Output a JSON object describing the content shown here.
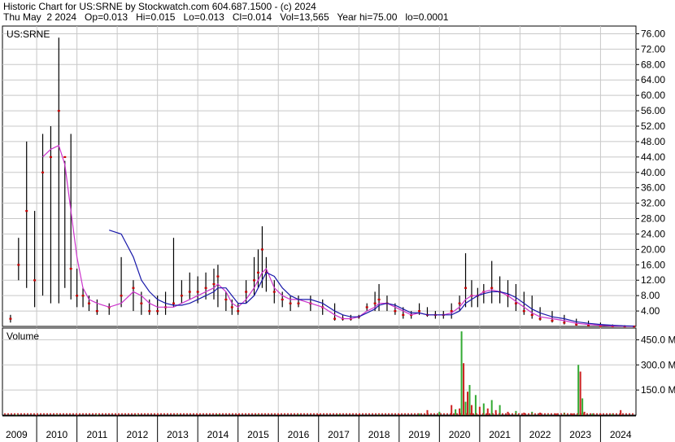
{
  "header": {
    "line1": "Historic Chart for US:SRNE by Stockwatch.com 604.687.1500 - (c) 2024",
    "line2": "Thu May  2 2024   Op=0.013   Hi=0.015   Lo=0.013   Cl=0.014   Vol=13,565   Year hi=75.00   lo=0.0001"
  },
  "colors": {
    "price_bar": "#000000",
    "close_marker": "#cc0000",
    "ma_short": "#cc33cc",
    "ma_long": "#1a1aaa",
    "volume_up": "#33aa33",
    "volume_down": "#cc2222",
    "grid": "#c8c8c8"
  },
  "chart_data": [
    {
      "type": "line",
      "title": "US:SRNE",
      "ylim": [
        0,
        78
      ],
      "y_ticks": [
        "4.00",
        "8.00",
        "12.00",
        "16.00",
        "20.00",
        "24.00",
        "28.00",
        "32.00",
        "36.00",
        "40.00",
        "44.00",
        "48.00",
        "52.00",
        "56.00",
        "60.00",
        "64.00",
        "68.00",
        "72.00",
        "76.00"
      ],
      "x_tick_labels": [
        "2009",
        "2010",
        "2011",
        "2012",
        "2013",
        "2014",
        "2015",
        "2016",
        "2017",
        "2018",
        "2019",
        "2020",
        "2021",
        "2022",
        "2023",
        "2024"
      ],
      "x": [
        2008.85,
        2009.05,
        2009.25,
        2009.45,
        2009.65,
        2009.85,
        2010.05,
        2010.2,
        2010.35,
        2010.5,
        2010.65,
        2010.8,
        2011.0,
        2011.3,
        2011.6,
        2011.9,
        2012.1,
        2012.3,
        2012.5,
        2012.7,
        2012.9,
        2013.1,
        2013.3,
        2013.5,
        2013.7,
        2013.9,
        2014.0,
        2014.2,
        2014.35,
        2014.5,
        2014.7,
        2014.9,
        2015.0,
        2015.1,
        2015.2,
        2015.4,
        2015.6,
        2015.8,
        2016.0,
        2016.3,
        2016.6,
        2016.9,
        2017.1,
        2017.3,
        2017.5,
        2017.7,
        2017.9,
        2018.0,
        2018.2,
        2018.4,
        2018.6,
        2018.8,
        2019.0,
        2019.2,
        2019.4,
        2019.6,
        2019.8,
        2020.0,
        2020.15,
        2020.3,
        2020.45,
        2020.6,
        2020.8,
        2021.0,
        2021.2,
        2021.4,
        2021.6,
        2021.8,
        2022.0,
        2022.3,
        2022.6,
        2022.9,
        2023.2,
        2023.5,
        2023.8,
        2024.1,
        2024.33
      ],
      "series": [
        {
          "kind": "ohlc",
          "high": [
            3,
            23,
            48,
            30,
            50,
            52,
            75,
            43,
            50,
            15,
            10,
            8,
            7,
            6,
            18,
            12,
            9,
            7,
            8,
            9,
            23,
            12,
            14,
            13,
            14,
            15,
            16,
            9,
            7,
            6,
            12,
            18,
            20,
            26,
            18,
            12,
            9,
            8,
            8,
            8,
            7,
            6,
            3,
            3,
            3,
            6,
            9,
            11,
            8,
            6,
            5,
            4,
            6,
            5,
            4,
            4,
            6,
            8,
            19,
            12,
            10,
            11,
            17,
            13,
            12,
            11,
            9,
            8,
            5,
            4,
            3,
            2,
            1.5,
            1,
            0.5,
            0.3,
            0.2
          ],
          "low": [
            1,
            12,
            10,
            5,
            8,
            6,
            6,
            10,
            7,
            5,
            5,
            4,
            3,
            3,
            5,
            4,
            3,
            3,
            3,
            3,
            5,
            6,
            7,
            6,
            7,
            7,
            5,
            4,
            3,
            3,
            6,
            8,
            10,
            10,
            9,
            6,
            5,
            4,
            5,
            4,
            3,
            1.5,
            1.5,
            1.5,
            2,
            4,
            4,
            4,
            4,
            3,
            2,
            2,
            3,
            2.5,
            2,
            2,
            2,
            4,
            5,
            5,
            5,
            6,
            6,
            6,
            5,
            4,
            3,
            2,
            1.5,
            1,
            0.5,
            0.2,
            0.1,
            0.05,
            0.02,
            0.01,
            0.01
          ],
          "close": [
            2,
            16,
            30,
            12,
            40,
            44,
            56,
            44,
            15,
            8,
            8,
            6,
            4,
            5,
            8,
            10,
            6,
            4,
            4,
            5,
            6,
            8,
            9,
            9,
            10,
            11,
            13,
            7,
            5,
            4,
            9,
            12,
            14,
            20,
            14,
            9,
            7,
            6,
            6,
            6,
            5,
            2,
            2,
            2,
            2.5,
            5,
            6,
            7,
            6,
            4,
            3,
            3,
            4,
            3,
            3,
            3,
            4,
            6,
            10,
            8,
            8,
            9,
            10,
            9,
            8,
            6,
            4,
            3,
            2,
            1.5,
            1,
            0.5,
            0.3,
            0.1,
            0.05,
            0.02,
            0.014
          ]
        },
        {
          "kind": "ma_short",
          "values": [
            null,
            null,
            null,
            null,
            44,
            46,
            47,
            42,
            30,
            18,
            10,
            7,
            6,
            5,
            6,
            9,
            8,
            6,
            5,
            5,
            5,
            6,
            7,
            8,
            9,
            10,
            11,
            9,
            6,
            5,
            7,
            10,
            12,
            14,
            15,
            10,
            8,
            7,
            7,
            6,
            5,
            3,
            2,
            2,
            2.5,
            4,
            5,
            6,
            6,
            5,
            4,
            3,
            3.5,
            3,
            3,
            3,
            3.5,
            5,
            7,
            8,
            8,
            9,
            9.5,
            9,
            8,
            6.5,
            5,
            3.5,
            2.5,
            2,
            1.5,
            0.8,
            0.5,
            0.3,
            0.1,
            0.05,
            0.03
          ]
        },
        {
          "kind": "ma_long",
          "values": [
            null,
            null,
            null,
            null,
            null,
            null,
            null,
            null,
            null,
            null,
            null,
            null,
            null,
            25,
            24,
            18,
            12,
            9,
            7,
            6,
            5.5,
            5.5,
            6,
            7,
            8,
            9,
            10,
            10,
            8,
            6,
            6,
            8,
            10,
            12,
            14,
            13,
            10,
            8,
            7,
            7,
            6,
            4,
            3,
            2.5,
            2.5,
            3.5,
            4.5,
            5.5,
            6,
            5.5,
            4.5,
            3.5,
            3.5,
            3,
            3,
            3,
            3,
            4,
            6,
            7,
            8,
            8.5,
            9,
            9,
            8.5,
            7.5,
            6,
            4.5,
            3.5,
            2.5,
            2,
            1.2,
            0.8,
            0.5,
            0.3,
            0.15,
            0.08
          ]
        }
      ]
    },
    {
      "type": "bar",
      "title": "Volume",
      "ylim": [
        0,
        520
      ],
      "y_ticks": [
        "150.0 M",
        "300.0 M",
        "450.0 M"
      ],
      "x": [
        2009.0,
        2009.5,
        2010.0,
        2010.5,
        2011.0,
        2011.5,
        2012.0,
        2012.5,
        2013.0,
        2013.5,
        2014.0,
        2014.5,
        2015.0,
        2015.5,
        2016.0,
        2016.5,
        2017.0,
        2017.5,
        2018.0,
        2018.5,
        2019.0,
        2019.2,
        2019.5,
        2019.8,
        2019.9,
        2020.0,
        2020.05,
        2020.1,
        2020.15,
        2020.2,
        2020.25,
        2020.3,
        2020.4,
        2020.5,
        2020.6,
        2020.7,
        2020.8,
        2020.9,
        2021.0,
        2021.2,
        2021.4,
        2021.6,
        2021.8,
        2022.0,
        2022.2,
        2022.4,
        2022.6,
        2022.8,
        2022.95,
        2023.0,
        2023.05,
        2023.1,
        2023.3,
        2023.5,
        2023.8,
        2024.0
      ],
      "values": [
        3,
        3,
        4,
        3,
        3,
        3,
        3,
        4,
        4,
        4,
        5,
        5,
        6,
        6,
        6,
        5,
        5,
        5,
        6,
        6,
        10,
        30,
        20,
        60,
        35,
        40,
        500,
        310,
        80,
        140,
        180,
        60,
        120,
        50,
        70,
        40,
        90,
        30,
        60,
        20,
        25,
        15,
        20,
        15,
        10,
        10,
        15,
        10,
        300,
        260,
        100,
        20,
        10,
        10,
        10,
        30
      ]
    }
  ]
}
